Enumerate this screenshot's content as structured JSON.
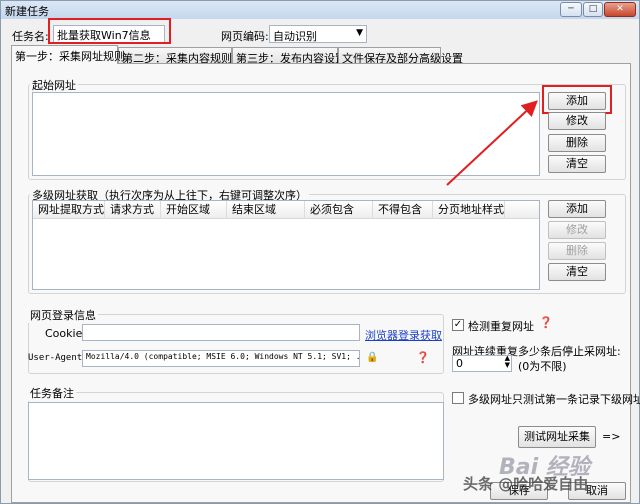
{
  "window": {
    "title": "新建任务",
    "controls": {
      "minimize": "─",
      "maximize": "□",
      "close": "✕"
    }
  },
  "header": {
    "task_name_label": "任务名:",
    "task_name_value": "批量获取Win7信息",
    "encoding_label": "网页编码:",
    "encoding_value": "自动识别"
  },
  "tabs": [
    {
      "label": "第一步：采集网址规则"
    },
    {
      "label": "第二步：采集内容规则"
    },
    {
      "label": "第三步：发布内容设置"
    },
    {
      "label": "文件保存及部分高级设置"
    }
  ],
  "start_url": {
    "title": "起始网址",
    "buttons": {
      "add": "添加",
      "edit": "修改",
      "delete": "删除",
      "clear": "清空"
    }
  },
  "multi_url": {
    "title": "多级网址获取（执行次序为从上往下，右键可调整次序）",
    "columns": [
      "网址提取方式",
      "请求方式",
      "开始区域",
      "结束区域",
      "必须包含",
      "不得包含",
      "分页地址样式"
    ],
    "buttons": {
      "add": "添加",
      "edit": "修改",
      "delete": "删除",
      "clear": "清空"
    }
  },
  "login": {
    "title": "网页登录信息",
    "cookie_label": "Cookie",
    "cookie_value": "",
    "browser_link": "浏览器登录获取",
    "user_agent_label": "User-Agent",
    "user_agent_value": "Mozilla/4.0 (compatible; MSIE 6.0; Windows NT 5.1; SV1; ."
  },
  "options": {
    "check_duplicate_label": "检测重复网址",
    "check_duplicate_checked": true,
    "stop_after_label": "网址连续重复多少条后停止采网址:",
    "stop_after_value": "0",
    "stop_after_hint": "(0为不限)",
    "only_first_label": "多级网址只测试第一条记录下级网址",
    "only_first_checked": false
  },
  "notes": {
    "title": "任务备注",
    "value": ""
  },
  "footer": {
    "test_button": "测试网址采集",
    "test_arrow": "=>",
    "save_button": "保存",
    "cancel_button": "取消"
  },
  "watermarks": {
    "baidu": "Bai 经验",
    "author": "头条 @哈哈爱自由"
  },
  "colors": {
    "highlight_red": "#e02020",
    "link_blue": "#1a3fc7"
  }
}
